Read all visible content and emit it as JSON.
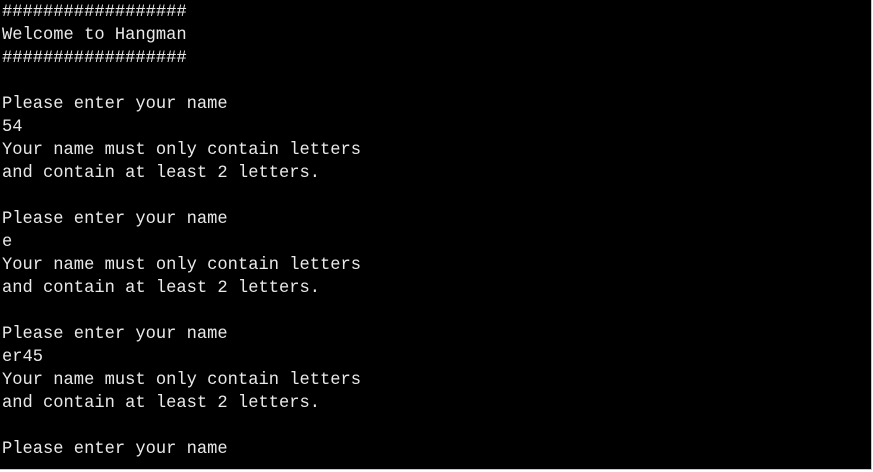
{
  "terminal": {
    "lines": [
      "##################",
      "Welcome to Hangman",
      "##################",
      "",
      "Please enter your name",
      "54",
      "Your name must only contain letters",
      "and contain at least 2 letters.",
      "",
      "Please enter your name",
      "e",
      "Your name must only contain letters",
      "and contain at least 2 letters.",
      "",
      "Please enter your name",
      "er45",
      "Your name must only contain letters",
      "and contain at least 2 letters.",
      "",
      "Please enter your name"
    ]
  },
  "colors": {
    "background": "#000000",
    "text": "#e9e9e9",
    "page": "#ffffff"
  }
}
